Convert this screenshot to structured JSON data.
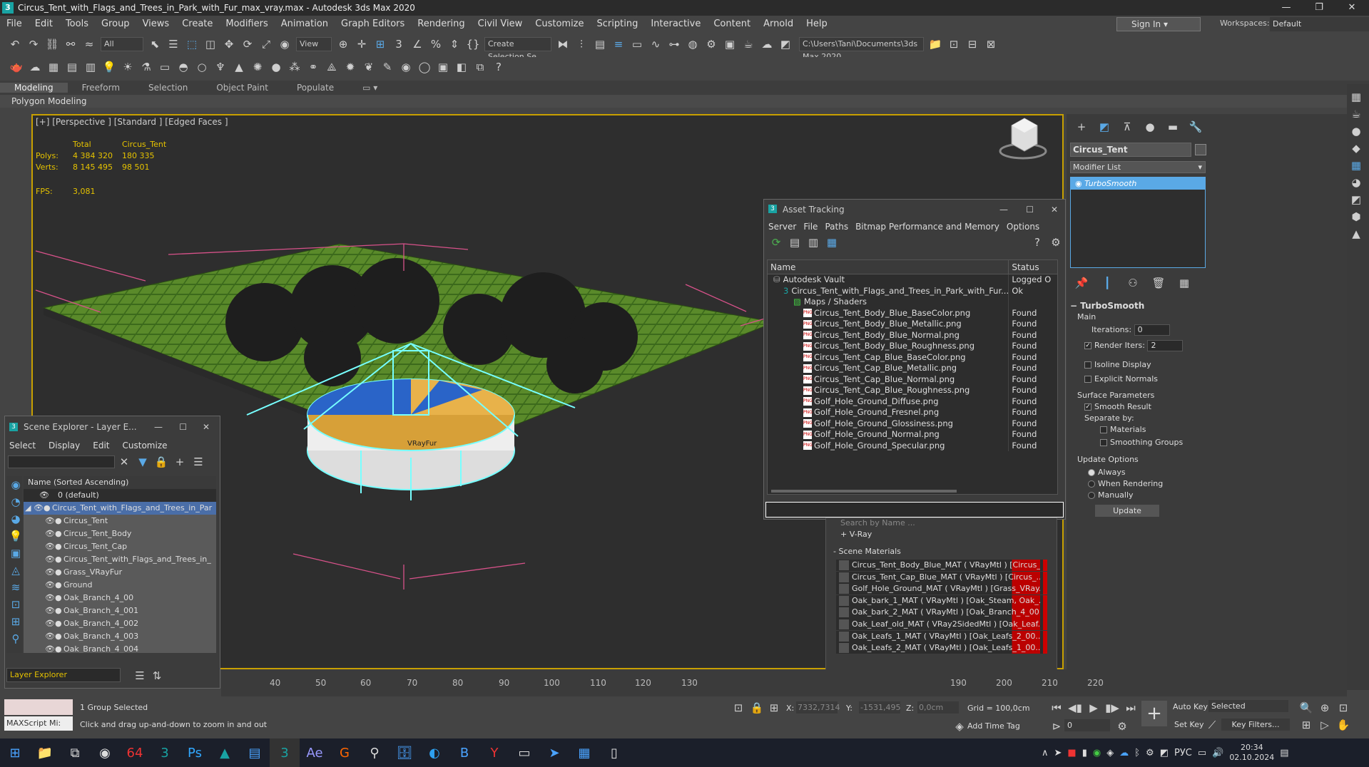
{
  "window": {
    "title": "Circus_Tent_with_Flags_and_Trees_in_Park_with_Fur_max_vray.max - Autodesk 3ds Max 2020",
    "app_icon": "3"
  },
  "menu": [
    "File",
    "Edit",
    "Tools",
    "Group",
    "Views",
    "Create",
    "Modifiers",
    "Animation",
    "Graph Editors",
    "Rendering",
    "Civil View",
    "Customize",
    "Scripting",
    "Interactive",
    "Content",
    "Arnold",
    "Help"
  ],
  "account": {
    "sign_in": "Sign In",
    "workspaces_label": "Workspaces:",
    "workspace": "Default"
  },
  "toolbar": {
    "filter": "All",
    "view": "View",
    "selection_set": "Create Selection Se",
    "path": "C:\\Users\\Tani\\Documents\\3ds Max 2020"
  },
  "ribbon": {
    "tabs": [
      "Modeling",
      "Freeform",
      "Selection",
      "Object Paint",
      "Populate"
    ],
    "active": "Modeling",
    "sub": "Polygon Modeling"
  },
  "viewport": {
    "label": "[+] [Perspective ] [Standard ] [Edged Faces ]",
    "stats": {
      "total_label": "Total",
      "obj_label": "Circus_Tent",
      "polys_label": "Polys:",
      "polys_total": "4 384 320",
      "polys_obj": "180 335",
      "verts_label": "Verts:",
      "verts_total": "8 145 495",
      "verts_obj": "98 501",
      "fps_label": "FPS:",
      "fps": "3,081"
    },
    "obj_tag": "VRayFur"
  },
  "asset_tracking": {
    "title": "Asset Tracking",
    "menu": [
      "Server",
      "File",
      "Paths",
      "Bitmap Performance and Memory",
      "Options"
    ],
    "col_name": "Name",
    "col_status": "Status",
    "rows": [
      {
        "name": "Autodesk Vault",
        "status": "Logged O",
        "indent": 0,
        "kind": "vault"
      },
      {
        "name": "Circus_Tent_with_Flags_and_Trees_in_Park_with_Fur...",
        "status": "Ok",
        "indent": 1,
        "kind": "max"
      },
      {
        "name": "Maps / Shaders",
        "status": "",
        "indent": 2,
        "kind": "folder"
      },
      {
        "name": "Circus_Tent_Body_Blue_BaseColor.png",
        "status": "Found",
        "indent": 3,
        "kind": "png"
      },
      {
        "name": "Circus_Tent_Body_Blue_Metallic.png",
        "status": "Found",
        "indent": 3,
        "kind": "png"
      },
      {
        "name": "Circus_Tent_Body_Blue_Normal.png",
        "status": "Found",
        "indent": 3,
        "kind": "png"
      },
      {
        "name": "Circus_Tent_Body_Blue_Roughness.png",
        "status": "Found",
        "indent": 3,
        "kind": "png"
      },
      {
        "name": "Circus_Tent_Cap_Blue_BaseColor.png",
        "status": "Found",
        "indent": 3,
        "kind": "png"
      },
      {
        "name": "Circus_Tent_Cap_Blue_Metallic.png",
        "status": "Found",
        "indent": 3,
        "kind": "png"
      },
      {
        "name": "Circus_Tent_Cap_Blue_Normal.png",
        "status": "Found",
        "indent": 3,
        "kind": "png"
      },
      {
        "name": "Circus_Tent_Cap_Blue_Roughness.png",
        "status": "Found",
        "indent": 3,
        "kind": "png"
      },
      {
        "name": "Golf_Hole_Ground_Diffuse.png",
        "status": "Found",
        "indent": 3,
        "kind": "png"
      },
      {
        "name": "Golf_Hole_Ground_Fresnel.png",
        "status": "Found",
        "indent": 3,
        "kind": "png"
      },
      {
        "name": "Golf_Hole_Ground_Glossiness.png",
        "status": "Found",
        "indent": 3,
        "kind": "png"
      },
      {
        "name": "Golf_Hole_Ground_Normal.png",
        "status": "Found",
        "indent": 3,
        "kind": "png"
      },
      {
        "name": "Golf_Hole_Ground_Specular.png",
        "status": "Found",
        "indent": 3,
        "kind": "png"
      }
    ]
  },
  "material_browser": {
    "search_placeholder": "Search by Name ...",
    "vray_group": "+ V-Ray",
    "scene_group": "- Scene Materials",
    "materials": [
      "Circus_Tent_Body_Blue_MAT ( VRayMtl ) [Circus_...",
      "Circus_Tent_Cap_Blue_MAT ( VRayMtl ) [Circus_...",
      "Golf_Hole_Ground_MAT ( VRayMtl ) [Grass_VRay...",
      "Oak_bark_1_MAT ( VRayMtl ) [Oak_Steam, Oak_...",
      "Oak_bark_2_MAT ( VRayMtl ) [Oak_Branch_4_00...",
      "Oak_Leaf_old_MAT ( VRay2SidedMtl ) [Oak_Leaf...",
      "Oak_Leafs_1_MAT ( VRayMtl ) [Oak_Leafs_2_00...",
      "Oak_Leafs_2_MAT ( VRayMtl ) [Oak_Leafs_1_00..."
    ]
  },
  "scene_explorer": {
    "title": "Scene Explorer - Layer E...",
    "menu": [
      "Select",
      "Display",
      "Edit",
      "Customize"
    ],
    "header": "Name (Sorted Ascending)",
    "rows": [
      {
        "name": "0 (default)",
        "indent": 1
      },
      {
        "name": "Circus_Tent_with_Flags_and_Trees_in_Par",
        "indent": 0
      },
      {
        "name": "Circus_Tent",
        "indent": 2
      },
      {
        "name": "Circus_Tent_Body",
        "indent": 2
      },
      {
        "name": "Circus_Tent_Cap",
        "indent": 2
      },
      {
        "name": "Circus_Tent_with_Flags_and_Trees_in_",
        "indent": 2
      },
      {
        "name": "Grass_VRayFur",
        "indent": 2
      },
      {
        "name": "Ground",
        "indent": 2
      },
      {
        "name": "Oak_Branch_4_00",
        "indent": 2
      },
      {
        "name": "Oak_Branch_4_001",
        "indent": 2
      },
      {
        "name": "Oak_Branch_4_002",
        "indent": 2
      },
      {
        "name": "Oak_Branch_4_003",
        "indent": 2
      },
      {
        "name": "Oak_Branch_4_004",
        "indent": 2
      }
    ],
    "footer": "Layer Explorer"
  },
  "modify_panel": {
    "object_name": "Circus_Tent",
    "modifier_list": "Modifier List",
    "stack_item": "TurboSmooth",
    "rollout": "TurboSmooth",
    "main": "Main",
    "iterations_label": "Iterations:",
    "iterations": "0",
    "render_iters_label": "Render Iters:",
    "render_iters": "2",
    "isoline": "Isoline Display",
    "explicit": "Explicit Normals",
    "surface": "Surface Parameters",
    "smooth_result": "Smooth Result",
    "separate": "Separate by:",
    "materials": "Materials",
    "smoothing_groups": "Smoothing Groups",
    "update_options": "Update Options",
    "always": "Always",
    "when_rendering": "When Rendering",
    "manually": "Manually",
    "update_btn": "Update"
  },
  "timeline": {
    "ticks": [
      "40",
      "50",
      "60",
      "70",
      "80",
      "90",
      "100",
      "110",
      "120",
      "130",
      "190",
      "200",
      "210",
      "220"
    ]
  },
  "status": {
    "maxscript": "MAXScript Mi:",
    "selected": "1 Group Selected",
    "prompt": "Click and drag up-and-down to zoom in and out",
    "x_label": "X:",
    "x": "7332,7314",
    "y_label": "Y:",
    "y": "-1531,495",
    "z_label": "Z:",
    "z": "0,0cm",
    "grid": "Grid = 100,0cm",
    "add_time_tag": "Add Time Tag",
    "auto_key": "Auto Key",
    "selected_dd": "Selected",
    "set_key": "Set Key",
    "key_filters": "Key Filters...",
    "frame": "0"
  },
  "tray": {
    "lang": "РУС",
    "time": "20:34",
    "date": "02.10.2024"
  }
}
